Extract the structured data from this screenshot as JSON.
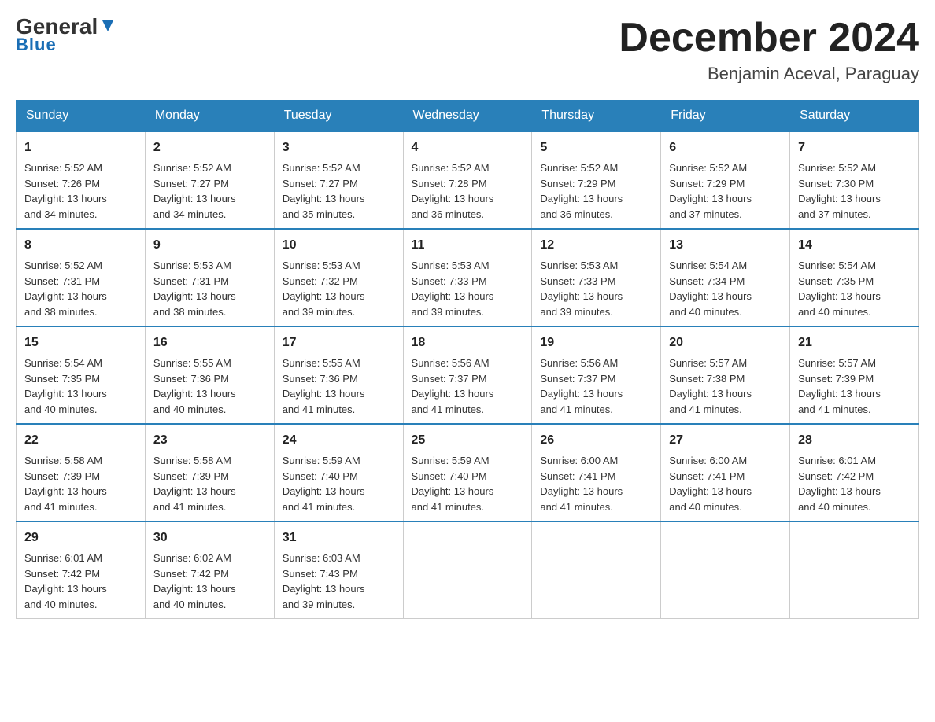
{
  "logo": {
    "text_general": "General",
    "text_blue": "Blue"
  },
  "title": "December 2024",
  "subtitle": "Benjamin Aceval, Paraguay",
  "days": [
    "Sunday",
    "Monday",
    "Tuesday",
    "Wednesday",
    "Thursday",
    "Friday",
    "Saturday"
  ],
  "weeks": [
    [
      {
        "num": "1",
        "sunrise": "5:52 AM",
        "sunset": "7:26 PM",
        "daylight": "13 hours and 34 minutes."
      },
      {
        "num": "2",
        "sunrise": "5:52 AM",
        "sunset": "7:27 PM",
        "daylight": "13 hours and 34 minutes."
      },
      {
        "num": "3",
        "sunrise": "5:52 AM",
        "sunset": "7:27 PM",
        "daylight": "13 hours and 35 minutes."
      },
      {
        "num": "4",
        "sunrise": "5:52 AM",
        "sunset": "7:28 PM",
        "daylight": "13 hours and 36 minutes."
      },
      {
        "num": "5",
        "sunrise": "5:52 AM",
        "sunset": "7:29 PM",
        "daylight": "13 hours and 36 minutes."
      },
      {
        "num": "6",
        "sunrise": "5:52 AM",
        "sunset": "7:29 PM",
        "daylight": "13 hours and 37 minutes."
      },
      {
        "num": "7",
        "sunrise": "5:52 AM",
        "sunset": "7:30 PM",
        "daylight": "13 hours and 37 minutes."
      }
    ],
    [
      {
        "num": "8",
        "sunrise": "5:52 AM",
        "sunset": "7:31 PM",
        "daylight": "13 hours and 38 minutes."
      },
      {
        "num": "9",
        "sunrise": "5:53 AM",
        "sunset": "7:31 PM",
        "daylight": "13 hours and 38 minutes."
      },
      {
        "num": "10",
        "sunrise": "5:53 AM",
        "sunset": "7:32 PM",
        "daylight": "13 hours and 39 minutes."
      },
      {
        "num": "11",
        "sunrise": "5:53 AM",
        "sunset": "7:33 PM",
        "daylight": "13 hours and 39 minutes."
      },
      {
        "num": "12",
        "sunrise": "5:53 AM",
        "sunset": "7:33 PM",
        "daylight": "13 hours and 39 minutes."
      },
      {
        "num": "13",
        "sunrise": "5:54 AM",
        "sunset": "7:34 PM",
        "daylight": "13 hours and 40 minutes."
      },
      {
        "num": "14",
        "sunrise": "5:54 AM",
        "sunset": "7:35 PM",
        "daylight": "13 hours and 40 minutes."
      }
    ],
    [
      {
        "num": "15",
        "sunrise": "5:54 AM",
        "sunset": "7:35 PM",
        "daylight": "13 hours and 40 minutes."
      },
      {
        "num": "16",
        "sunrise": "5:55 AM",
        "sunset": "7:36 PM",
        "daylight": "13 hours and 40 minutes."
      },
      {
        "num": "17",
        "sunrise": "5:55 AM",
        "sunset": "7:36 PM",
        "daylight": "13 hours and 41 minutes."
      },
      {
        "num": "18",
        "sunrise": "5:56 AM",
        "sunset": "7:37 PM",
        "daylight": "13 hours and 41 minutes."
      },
      {
        "num": "19",
        "sunrise": "5:56 AM",
        "sunset": "7:37 PM",
        "daylight": "13 hours and 41 minutes."
      },
      {
        "num": "20",
        "sunrise": "5:57 AM",
        "sunset": "7:38 PM",
        "daylight": "13 hours and 41 minutes."
      },
      {
        "num": "21",
        "sunrise": "5:57 AM",
        "sunset": "7:39 PM",
        "daylight": "13 hours and 41 minutes."
      }
    ],
    [
      {
        "num": "22",
        "sunrise": "5:58 AM",
        "sunset": "7:39 PM",
        "daylight": "13 hours and 41 minutes."
      },
      {
        "num": "23",
        "sunrise": "5:58 AM",
        "sunset": "7:39 PM",
        "daylight": "13 hours and 41 minutes."
      },
      {
        "num": "24",
        "sunrise": "5:59 AM",
        "sunset": "7:40 PM",
        "daylight": "13 hours and 41 minutes."
      },
      {
        "num": "25",
        "sunrise": "5:59 AM",
        "sunset": "7:40 PM",
        "daylight": "13 hours and 41 minutes."
      },
      {
        "num": "26",
        "sunrise": "6:00 AM",
        "sunset": "7:41 PM",
        "daylight": "13 hours and 41 minutes."
      },
      {
        "num": "27",
        "sunrise": "6:00 AM",
        "sunset": "7:41 PM",
        "daylight": "13 hours and 40 minutes."
      },
      {
        "num": "28",
        "sunrise": "6:01 AM",
        "sunset": "7:42 PM",
        "daylight": "13 hours and 40 minutes."
      }
    ],
    [
      {
        "num": "29",
        "sunrise": "6:01 AM",
        "sunset": "7:42 PM",
        "daylight": "13 hours and 40 minutes."
      },
      {
        "num": "30",
        "sunrise": "6:02 AM",
        "sunset": "7:42 PM",
        "daylight": "13 hours and 40 minutes."
      },
      {
        "num": "31",
        "sunrise": "6:03 AM",
        "sunset": "7:43 PM",
        "daylight": "13 hours and 39 minutes."
      },
      null,
      null,
      null,
      null
    ]
  ],
  "labels": {
    "sunrise": "Sunrise:",
    "sunset": "Sunset:",
    "daylight": "Daylight:"
  }
}
